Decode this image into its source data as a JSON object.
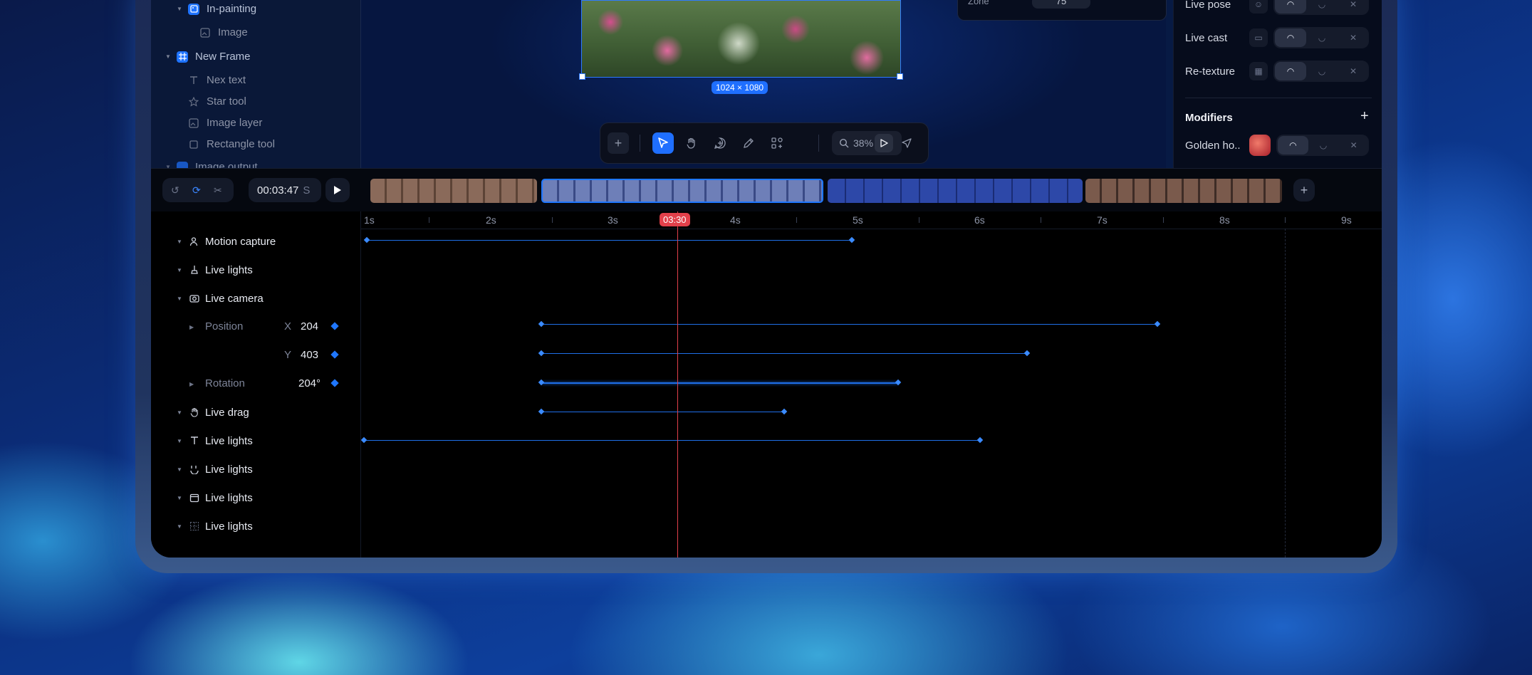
{
  "layers": [
    {
      "label": "In-painting",
      "icon": "inpainting-icon"
    },
    {
      "label": "Image",
      "icon": "image-icon"
    },
    {
      "label": "New Frame",
      "icon": "frame-icon"
    },
    {
      "label": "Nex text",
      "icon": "text-icon"
    },
    {
      "label": "Star tool",
      "icon": "star-icon"
    },
    {
      "label": "Image layer",
      "icon": "image-icon"
    },
    {
      "label": "Rectangle tool",
      "icon": "rectangle-icon"
    },
    {
      "label": "Image output",
      "icon": "image-output-icon"
    }
  ],
  "canvas": {
    "size_badge": "1024 × 1080",
    "zoom": "38%",
    "zone_label": "Zone",
    "zone_value": "75"
  },
  "right_panel": {
    "rows": [
      {
        "label": "Live pose",
        "icon": "pose-icon"
      },
      {
        "label": "Live cast",
        "icon": "cast-icon"
      },
      {
        "label": "Re-texture",
        "icon": "texture-icon"
      }
    ],
    "modifiers_title": "Modifiers",
    "modifier": {
      "label": "Golden ho..",
      "icon": "golden-hour-thumbnail"
    }
  },
  "transport": {
    "time": "00:03:47",
    "time_unit": "S"
  },
  "ruler": {
    "labels": [
      "1s",
      "2s",
      "3s",
      "4s",
      "5s",
      "6s",
      "7s",
      "8s",
      "9s"
    ],
    "playhead": "03:30"
  },
  "tracks": [
    {
      "label": "Motion capture",
      "icon": "motion-capture-icon"
    },
    {
      "label": "Live lights",
      "icon": "live-lights-icon"
    },
    {
      "label": "Live camera",
      "icon": "camera-icon"
    },
    {
      "label": "Live drag",
      "icon": "hand-icon"
    },
    {
      "label": "Live lights",
      "icon": "text-icon"
    },
    {
      "label": "Live lights",
      "icon": "face-icon"
    },
    {
      "label": "Live lights",
      "icon": "calendar-icon"
    },
    {
      "label": "Live lights",
      "icon": "grid-icon"
    }
  ],
  "camera_props": {
    "position_label": "Position",
    "x_label": "X",
    "x_value": "204",
    "y_label": "Y",
    "y_value": "403",
    "rotation_label": "Rotation",
    "rotation_value": "204°"
  },
  "colors": {
    "accent": "#1f77ff",
    "playhead": "#e2404a",
    "keyframe_line": "#1f6fe8"
  }
}
